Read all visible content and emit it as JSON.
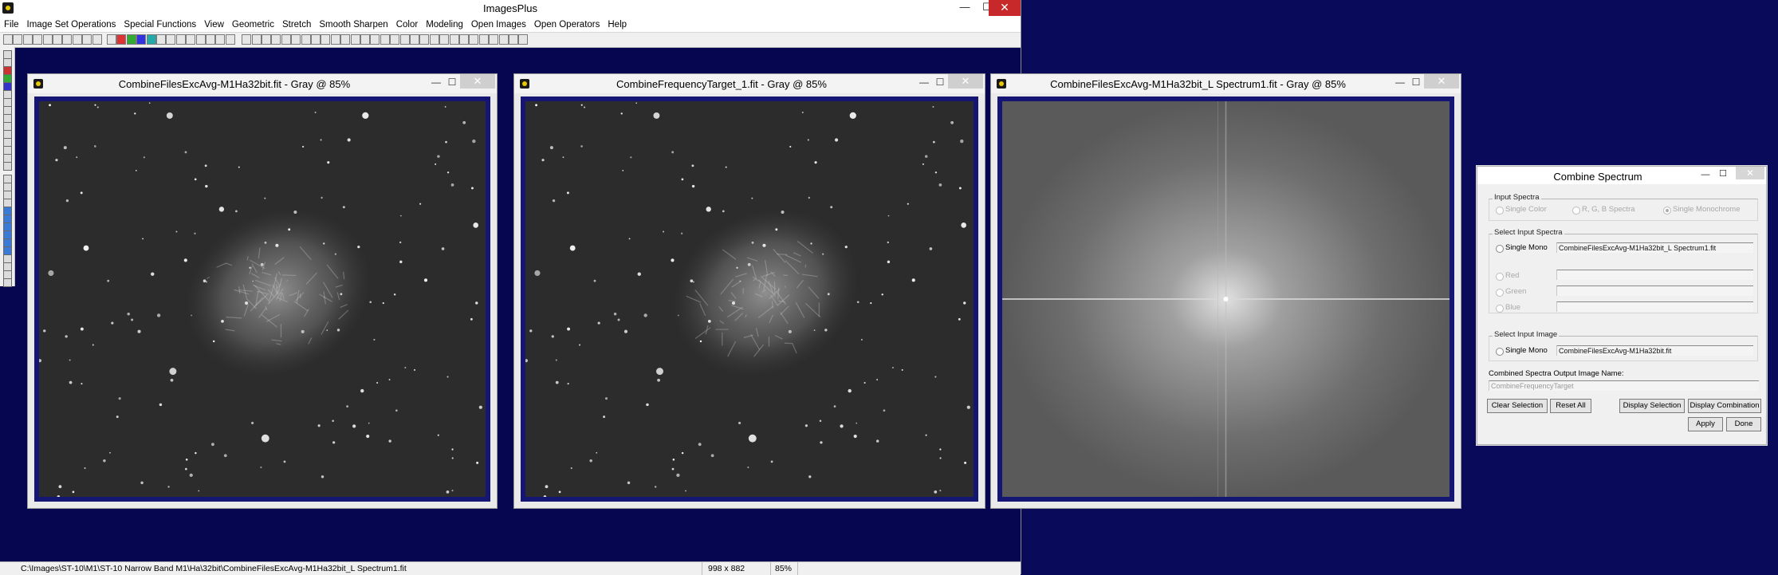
{
  "app": {
    "title": "ImagesPlus",
    "window_controls": {
      "minimize": "—",
      "maximize": "☐",
      "close": "✕"
    }
  },
  "menu": [
    "File",
    "Image Set Operations",
    "Special Functions",
    "View",
    "Geometric",
    "Stretch",
    "Smooth Sharpen",
    "Color",
    "Modeling",
    "Open Images",
    "Open Operators",
    "Help"
  ],
  "windows": [
    {
      "title": "CombineFilesExcAvg-M1Ha32bit.fit - Gray @ 85%",
      "type": "nebula"
    },
    {
      "title": "CombineFrequencyTarget_1.fit - Gray @ 85%",
      "type": "nebula"
    },
    {
      "title": "CombineFilesExcAvg-M1Ha32bit_L Spectrum1.fit - Gray @ 85%",
      "type": "spectrum"
    }
  ],
  "statusbar": {
    "path": "C:\\Images\\ST-10\\M1\\ST-10 Narrow Band M1\\Ha\\32bit\\CombineFilesExcAvg-M1Ha32bit_L Spectrum1.fit",
    "dimensions": "998 x 882",
    "zoom": "85%"
  },
  "dialog": {
    "title": "Combine Spectrum",
    "input_spectra": {
      "label": "Input Spectra",
      "options": [
        "Single Color",
        "R, G, B Spectra",
        "Single Monochrome"
      ],
      "selected": "Single Monochrome"
    },
    "select_input_spectra": {
      "label": "Select Input Spectra",
      "single_mono_label": "Single Mono",
      "single_mono_value": "CombineFilesExcAvg-M1Ha32bit_L Spectrum1.fit",
      "red_label": "Red",
      "green_label": "Green",
      "blue_label": "Blue"
    },
    "select_input_image": {
      "label": "Select Input Image",
      "single_mono_label": "Single Mono",
      "single_mono_value": "CombineFilesExcAvg-M1Ha32bit.fit"
    },
    "output_name_label": "Combined Spectra Output Image Name:",
    "output_name_value": "CombineFrequencyTarget",
    "buttons": {
      "clear_selection": "Clear Selection",
      "reset_all": "Reset All",
      "display_selection": "Display Selection",
      "display_combination": "Display Combination",
      "apply": "Apply",
      "done": "Done"
    }
  },
  "colors": {
    "desktop": "#0a0a5a",
    "image_frame": "#151573",
    "close_red": "#c7282a"
  }
}
